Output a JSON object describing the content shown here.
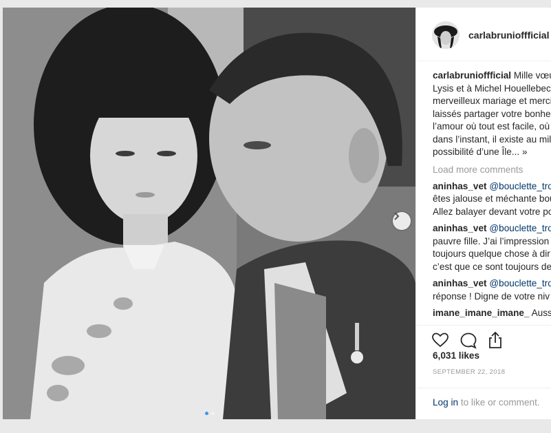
{
  "post": {
    "username": "carlabrunioffficial",
    "caption_user": "carlabrunioffficial",
    "caption_lines": [
      "Mille vœux",
      "Lysis et à Michel Houellebecq",
      "merveilleux mariage et merci",
      "laissés partager votre bonhe",
      "l’amour où tout est facile, où",
      "dans l’instant, il existe au mil",
      "possibilité d’une Île... »"
    ],
    "load_more": "Load more comments",
    "comments": [
      {
        "user": "aninhas_vet",
        "mention": "@bouclette_trop",
        "lines": [
          "êtes jalouse et méchante bou",
          "Allez balayer devant votre po"
        ]
      },
      {
        "user": "aninhas_vet",
        "mention": "@bouclette_trop",
        "lines": [
          "pauvre fille. J’ai l’impression c",
          "toujours quelque chose à dir",
          "c’est que ce sont toujours de"
        ]
      },
      {
        "user": "aninhas_vet",
        "mention": "@bouclette_trop",
        "lines": [
          "réponse ! Digne de votre niv"
        ]
      },
      {
        "user": "imane_imane_imane_",
        "text": "Aussi"
      }
    ],
    "likes": "6,031 likes",
    "date": "SEPTEMBER 22, 2018",
    "login_link": "Log in",
    "login_suffix": " to like or comment.",
    "icons": [
      "heart-icon",
      "comment-icon",
      "share-icon",
      "chevron-right-icon",
      "verified-badge-icon"
    ],
    "carousel_dots": 2,
    "colors": {
      "accent": "#3897f0",
      "link": "#003569",
      "muted": "#999999"
    }
  }
}
